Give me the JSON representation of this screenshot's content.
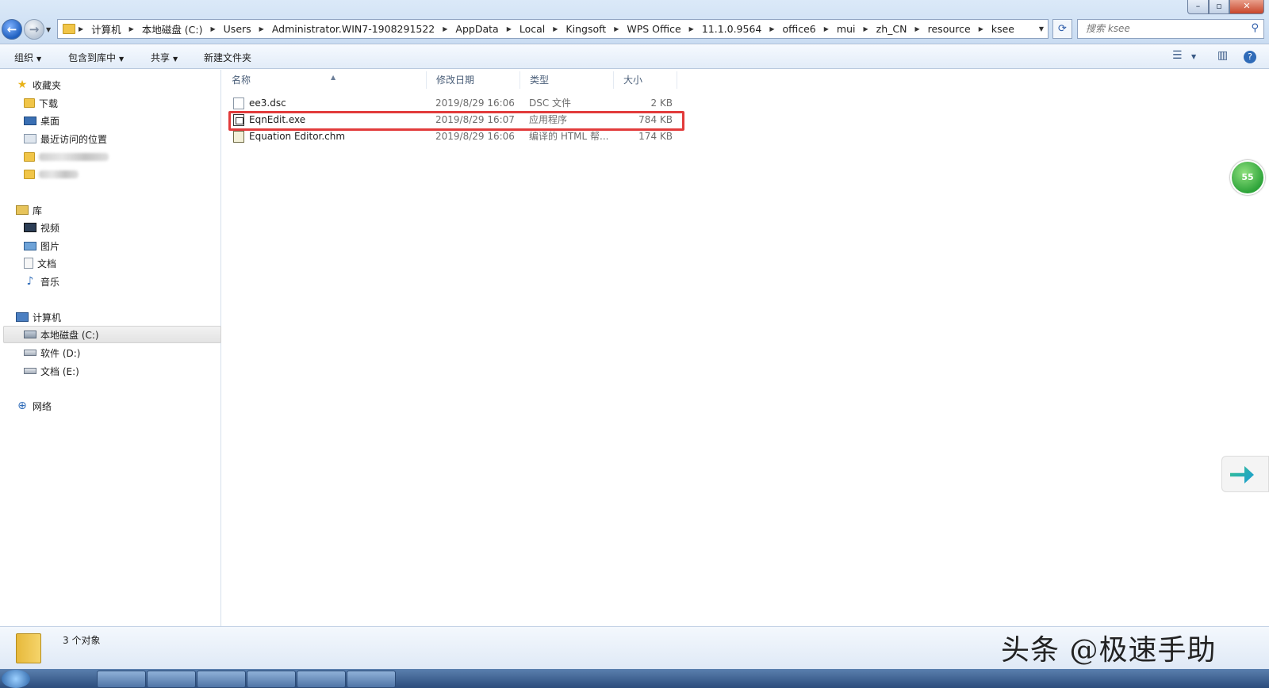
{
  "address_bar": {
    "crumbs": [
      "计算机",
      "本地磁盘 (C:)",
      "Users",
      "Administrator.WIN7-1908291522",
      "AppData",
      "Local",
      "Kingsoft",
      "WPS Office",
      "11.1.0.9564",
      "office6",
      "mui",
      "zh_CN",
      "resource",
      "ksee"
    ],
    "search_placeholder": "搜索 ksee"
  },
  "window_controls": {
    "minimize": "–",
    "maximize": "▫",
    "close": "✕"
  },
  "toolbar": {
    "organize": "组织",
    "include_library": "包含到库中",
    "share": "共享",
    "new_folder": "新建文件夹"
  },
  "sidebar": {
    "favorites": {
      "label": "收藏夹",
      "items": [
        "下载",
        "桌面",
        "最近访问的位置"
      ]
    },
    "libraries": {
      "label": "库",
      "items": [
        "视频",
        "图片",
        "文档",
        "音乐"
      ]
    },
    "computer": {
      "label": "计算机",
      "items": [
        "本地磁盘 (C:)",
        "软件 (D:)",
        "文档 (E:)"
      ]
    },
    "network": {
      "label": "网络"
    }
  },
  "columns": {
    "name": "名称",
    "modified": "修改日期",
    "type": "类型",
    "size": "大小"
  },
  "files": [
    {
      "name": "ee3.dsc",
      "modified": "2019/8/29 16:06",
      "type": "DSC 文件",
      "size": "2 KB",
      "icon": "dsc-file-icon"
    },
    {
      "name": "EqnEdit.exe",
      "modified": "2019/8/29 16:07",
      "type": "应用程序",
      "size": "784 KB",
      "icon": "exe-file-icon"
    },
    {
      "name": "Equation Editor.chm",
      "modified": "2019/8/29 16:06",
      "type": "编译的 HTML 帮...",
      "size": "174 KB",
      "icon": "chm-file-icon"
    }
  ],
  "status": {
    "count_text": "3 个对象"
  },
  "side_badge": "55",
  "watermark": "头条 @极速手助",
  "colors": {
    "highlight": "#e23b3b",
    "accent": "#2a5aa8"
  }
}
